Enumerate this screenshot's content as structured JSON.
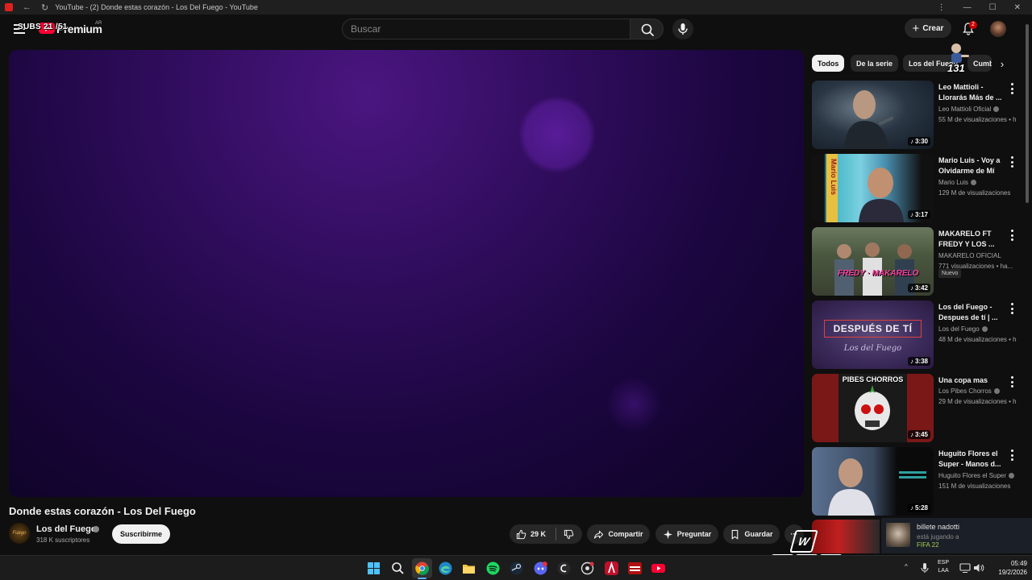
{
  "browser": {
    "tab_title": "YouTube - (2) Donde estas corazón - Los Del Fuego - YouTube",
    "back_glyph": "←",
    "reload_glyph": "↻",
    "minimize_glyph": "—",
    "maximize_glyph": "☐",
    "close_glyph": "✕",
    "extensions_glyph": "⋮"
  },
  "header": {
    "logo_text": "Premium",
    "country_code": "AR",
    "subs_overlay": "SUBS 21 /51",
    "search_placeholder": "Buscar",
    "create_label": "Crear",
    "notification_count": "2"
  },
  "video": {
    "title": "Donde estas corazón - Los Del Fuego",
    "channel_name": "Los del Fuego",
    "channel_avatar_text": "Fuego",
    "subscribers": "318 K suscriptores",
    "subscribe_label": "Suscribirme",
    "likes": "29 K",
    "share_label": "Compartir",
    "ask_label": "Preguntar",
    "save_label": "Guardar",
    "more_label": "···"
  },
  "chips": [
    {
      "label": "Todos",
      "active": true
    },
    {
      "label": "De la serie",
      "active": false
    },
    {
      "label": "Los del Fuego",
      "active": false
    },
    {
      "label": "Cumbia",
      "active": false
    }
  ],
  "sticker_number": "131",
  "recommendations": [
    {
      "title": "Leo Mattioli - Llorarás Más de ...",
      "channel": "Leo Mattioli Oficial",
      "views": "55 M de visualizaciones • h",
      "duration": "3:30",
      "verified": true,
      "badge": ""
    },
    {
      "title": "Mario Luis - Voy a Olvidarme de Mí",
      "channel": "Mario Luis",
      "views": "129 M de visualizaciones",
      "duration": "3:17",
      "verified": true,
      "badge": ""
    },
    {
      "title": "MAKARELO FT FREDY Y LOS ...",
      "channel": "MAKARELO OFICIAL",
      "views": "771 visualizaciones • ha...",
      "duration": "3:42",
      "verified": false,
      "badge": "Nuevo"
    },
    {
      "title": "Los del Fuego - Despues de tí | ...",
      "channel": "Los del Fuego",
      "views": "48 M de visualizaciones • h",
      "duration": "3:38",
      "verified": true,
      "badge": ""
    },
    {
      "title": "Una copa mas",
      "channel": "Los Pibes Chorros",
      "views": "29 M de visualizaciones • h",
      "duration": "3:45",
      "verified": true,
      "badge": ""
    },
    {
      "title": "Huguito Flores el Super - Manos d...",
      "channel": "Huguito Flores el Super",
      "views": "151 M de visualizaciones",
      "duration": "5:28",
      "verified": true,
      "badge": ""
    }
  ],
  "thumb_texts": {
    "mario": "Mario Luis",
    "despues": "DESPUÉS DE TÍ",
    "despues_sub": "Los del Fuego",
    "pibes": "PIBES CHORROS",
    "makarelo": "FREDY · MAKARELO"
  },
  "notification": {
    "name": "billete nadotti",
    "status": "está jugando a",
    "game": "FIFA 22"
  },
  "wasd": [
    "W",
    "A",
    "S",
    "D"
  ],
  "taskbar": {
    "lang_line1": "ESP",
    "lang_line2": "LAA",
    "time": "05:49",
    "date": "19/2/2026",
    "tray_arrow": "^"
  },
  "colors": {
    "accent_red": "#ff0033",
    "background": "#0f0f0f",
    "chip_bg": "#272727",
    "player_purple": "#2e0c5a"
  }
}
